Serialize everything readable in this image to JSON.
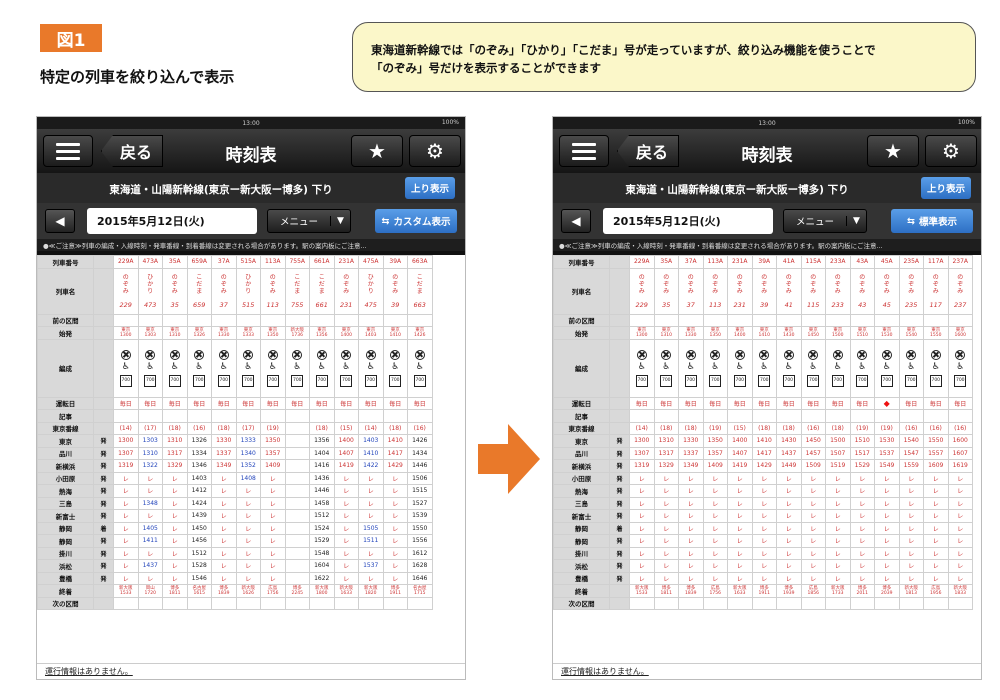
{
  "figure": {
    "tag": "図1",
    "subtitle": "特定の列車を絞り込んで表示",
    "callout_line1": "東海道新幹線では「のぞみ」「ひかり」「こだま」号が走っていますが、絞り込み機能を使うことで",
    "callout_line2": "「のぞみ」号だけを表示することができます"
  },
  "colors": {
    "tag": "#e9792a",
    "callout_bg": "#fbf7c9",
    "arrow": "#e9792a",
    "button_blue": "#2d6fc4"
  },
  "app": {
    "time": "13:00",
    "battery": "100%",
    "back": "戻る",
    "title": "時刻表",
    "route": "東海道・山陽新幹線(東京ー新大阪ー博多) 下り",
    "up_button": "上り表示",
    "date": "2015年5月12日(火)",
    "menu": "メニュー",
    "notice": "●≪ご注意≫列車の編成・入線時刻・発車番線・到着番線は変更される場合があります。駅の案内板にご注意...",
    "footer": "運行情報はありません。",
    "star_icon": "star-icon",
    "gear_icon": "gear-icon"
  },
  "labels": {
    "row_train_no": "列車番号",
    "row_train_name": "列車名",
    "row_prev": "前の区間",
    "row_origin": "始発",
    "row_formation": "編成",
    "row_service_day": "運転日",
    "row_note": "記事",
    "row_tokaido": "東京番線",
    "row_terminal": "終着",
    "row_next": "次の区間",
    "dep": "発",
    "arr": "着",
    "daily": "毎日",
    "pass": "レ"
  },
  "stations": [
    {
      "name": "東京",
      "mark": "発"
    },
    {
      "name": "品川",
      "mark": "発"
    },
    {
      "name": "新横浜",
      "mark": "発"
    },
    {
      "name": "小田原",
      "mark": "発"
    },
    {
      "name": "熱海",
      "mark": "発"
    },
    {
      "name": "三島",
      "mark": "発"
    },
    {
      "name": "新富士",
      "mark": "発"
    },
    {
      "name": "静岡",
      "mark": "着"
    },
    {
      "name": "静岡",
      "mark": "発"
    },
    {
      "name": "掛川",
      "mark": "発"
    },
    {
      "name": "浜松",
      "mark": "発"
    },
    {
      "name": "豊橋",
      "mark": "発"
    }
  ],
  "left": {
    "custom_button": "カスタム表示",
    "trains": [
      {
        "no": "229A",
        "kind": "のぞみ",
        "num": "229",
        "orig": "東京\n1300",
        "track": "(14)",
        "times": [
          "1300",
          "1307",
          "1319",
          "レ",
          "レ",
          "レ",
          "レ",
          "レ",
          "レ",
          "レ",
          "レ",
          "レ"
        ],
        "dest": "新大阪\n1533",
        "blue": false
      },
      {
        "no": "473A",
        "kind": "ひかり",
        "num": "473",
        "orig": "東京\n1303",
        "track": "(17)",
        "times": [
          "1303",
          "1310",
          "1322",
          "レ",
          "レ",
          "1348",
          "レ",
          "1405",
          "1411",
          "レ",
          "1437",
          "レ"
        ],
        "dest": "岡山\n1720",
        "blue": true
      },
      {
        "no": "35A",
        "kind": "のぞみ",
        "num": "35",
        "orig": "東京\n1310",
        "track": "(18)",
        "times": [
          "1310",
          "1317",
          "1329",
          "レ",
          "レ",
          "レ",
          "レ",
          "レ",
          "レ",
          "レ",
          "レ",
          "レ"
        ],
        "dest": "博多\n1811",
        "blue": false
      },
      {
        "no": "659A",
        "kind": "こだま",
        "num": "659",
        "orig": "東京\n1326",
        "track": "(16)",
        "times": [
          "1326",
          "1334",
          "1346",
          "1403",
          "1412",
          "1424",
          "1439",
          "1450",
          "1456",
          "1512",
          "1528",
          "1546"
        ],
        "dest": "名古屋\n1615",
        "blue": false,
        "dark": true
      },
      {
        "no": "37A",
        "kind": "のぞみ",
        "num": "37",
        "orig": "東京\n1330",
        "track": "(18)",
        "times": [
          "1330",
          "1337",
          "1349",
          "レ",
          "レ",
          "レ",
          "レ",
          "レ",
          "レ",
          "レ",
          "レ",
          "レ"
        ],
        "dest": "博多\n1839",
        "blue": false
      },
      {
        "no": "515A",
        "kind": "ひかり",
        "num": "515",
        "orig": "東京\n1333",
        "track": "(17)",
        "times": [
          "1333",
          "1340",
          "1352",
          "1408",
          "レ",
          "レ",
          "レ",
          "レ",
          "レ",
          "レ",
          "レ",
          "レ"
        ],
        "dest": "新大阪\n1626",
        "blue": true
      },
      {
        "no": "113A",
        "kind": "のぞみ",
        "num": "113",
        "orig": "東京\n1350",
        "track": "(19)",
        "times": [
          "1350",
          "1357",
          "1409",
          "レ",
          "レ",
          "レ",
          "レ",
          "レ",
          "レ",
          "レ",
          "レ",
          "レ"
        ],
        "dest": "広島\n1756",
        "blue": false
      },
      {
        "no": "755A",
        "kind": "こだま",
        "num": "755",
        "orig": "新大阪\n1736",
        "track": "",
        "times": [
          "",
          "",
          "",
          "",
          "",
          "",
          "",
          "",
          "",
          "",
          "",
          ""
        ],
        "dest": "博多\n2245",
        "blue": false,
        "dark": true
      },
      {
        "no": "661A",
        "kind": "こだま",
        "num": "661",
        "orig": "東京\n1356",
        "track": "(18)",
        "times": [
          "1356",
          "1404",
          "1416",
          "1436",
          "1446",
          "1458",
          "1512",
          "1524",
          "1529",
          "1548",
          "1604",
          "1622"
        ],
        "dest": "新大阪\n1800",
        "blue": false,
        "dark": true
      },
      {
        "no": "231A",
        "kind": "のぞみ",
        "num": "231",
        "orig": "東京\n1400",
        "track": "(15)",
        "times": [
          "1400",
          "1407",
          "1419",
          "レ",
          "レ",
          "レ",
          "レ",
          "レ",
          "レ",
          "レ",
          "レ",
          "レ"
        ],
        "dest": "新大阪\n1633",
        "blue": false
      },
      {
        "no": "475A",
        "kind": "ひかり",
        "num": "475",
        "orig": "東京\n1403",
        "track": "(14)",
        "times": [
          "1403",
          "1410",
          "1422",
          "レ",
          "レ",
          "レ",
          "レ",
          "1505",
          "1511",
          "レ",
          "1537",
          "レ"
        ],
        "dest": "新大阪\n1820",
        "blue": true
      },
      {
        "no": "39A",
        "kind": "のぞみ",
        "num": "39",
        "orig": "東京\n1410",
        "track": "(18)",
        "times": [
          "1410",
          "1417",
          "1429",
          "レ",
          "レ",
          "レ",
          "レ",
          "レ",
          "レ",
          "レ",
          "レ",
          "レ"
        ],
        "dest": "博多\n1911",
        "blue": false
      },
      {
        "no": "663A",
        "kind": "こだま",
        "num": "663",
        "orig": "東京\n1426",
        "track": "(16)",
        "times": [
          "1426",
          "1434",
          "1446",
          "1506",
          "1515",
          "1527",
          "1539",
          "1550",
          "1556",
          "1612",
          "1628",
          "1646"
        ],
        "dest": "名古屋\n1715",
        "blue": false,
        "dark": true
      }
    ]
  },
  "right": {
    "custom_button": "標準表示",
    "trains": [
      {
        "no": "229A",
        "kind": "のぞみ",
        "num": "229",
        "orig": "東京\n1300",
        "track": "(14)",
        "times": [
          "1300",
          "1307",
          "1319"
        ],
        "dest": "新大阪\n1533"
      },
      {
        "no": "35A",
        "kind": "のぞみ",
        "num": "35",
        "orig": "東京\n1310",
        "track": "(18)",
        "times": [
          "1310",
          "1317",
          "1329"
        ],
        "dest": "博多\n1811"
      },
      {
        "no": "37A",
        "kind": "のぞみ",
        "num": "37",
        "orig": "東京\n1330",
        "track": "(18)",
        "times": [
          "1330",
          "1337",
          "1349"
        ],
        "dest": "博多\n1839"
      },
      {
        "no": "113A",
        "kind": "のぞみ",
        "num": "113",
        "orig": "東京\n1350",
        "track": "(19)",
        "times": [
          "1350",
          "1357",
          "1409"
        ],
        "dest": "広島\n1756"
      },
      {
        "no": "231A",
        "kind": "のぞみ",
        "num": "231",
        "orig": "東京\n1400",
        "track": "(15)",
        "times": [
          "1400",
          "1407",
          "1419"
        ],
        "dest": "新大阪\n1633"
      },
      {
        "no": "39A",
        "kind": "のぞみ",
        "num": "39",
        "orig": "東京\n1410",
        "track": "(18)",
        "times": [
          "1410",
          "1417",
          "1429"
        ],
        "dest": "博多\n1911"
      },
      {
        "no": "41A",
        "kind": "のぞみ",
        "num": "41",
        "orig": "東京\n1430",
        "track": "(18)",
        "times": [
          "1430",
          "1437",
          "1449"
        ],
        "dest": "博多\n1939"
      },
      {
        "no": "115A",
        "kind": "のぞみ",
        "num": "115",
        "orig": "東京\n1450",
        "track": "(16)",
        "times": [
          "1450",
          "1457",
          "1509"
        ],
        "dest": "広島\n1856"
      },
      {
        "no": "233A",
        "kind": "のぞみ",
        "num": "233",
        "orig": "東京\n1500",
        "track": "(18)",
        "times": [
          "1500",
          "1507",
          "1519"
        ],
        "dest": "新大阪\n1733"
      },
      {
        "no": "43A",
        "kind": "のぞみ",
        "num": "43",
        "orig": "東京\n1510",
        "track": "(19)",
        "times": [
          "1510",
          "1517",
          "1529"
        ],
        "dest": "博多\n2011"
      },
      {
        "no": "45A",
        "kind": "のぞみ",
        "num": "45",
        "orig": "東京\n1530",
        "track": "(19)",
        "times": [
          "1530",
          "1537",
          "1549"
        ],
        "dest": "博多\n2039"
      },
      {
        "no": "235A",
        "kind": "のぞみ",
        "num": "235",
        "orig": "東京\n1540",
        "track": "(16)",
        "times": [
          "1540",
          "1547",
          "1559"
        ],
        "dest": "新大阪\n1813"
      },
      {
        "no": "117A",
        "kind": "のぞみ",
        "num": "117",
        "orig": "東京\n1550",
        "track": "(16)",
        "times": [
          "1550",
          "1557",
          "1609"
        ],
        "dest": "広島\n1956"
      },
      {
        "no": "237A",
        "kind": "のぞみ",
        "num": "237",
        "orig": "東京\n1600",
        "track": "(16)",
        "times": [
          "1600",
          "1607",
          "1619"
        ],
        "dest": "新大阪\n1833"
      }
    ],
    "dot_column": 11
  }
}
